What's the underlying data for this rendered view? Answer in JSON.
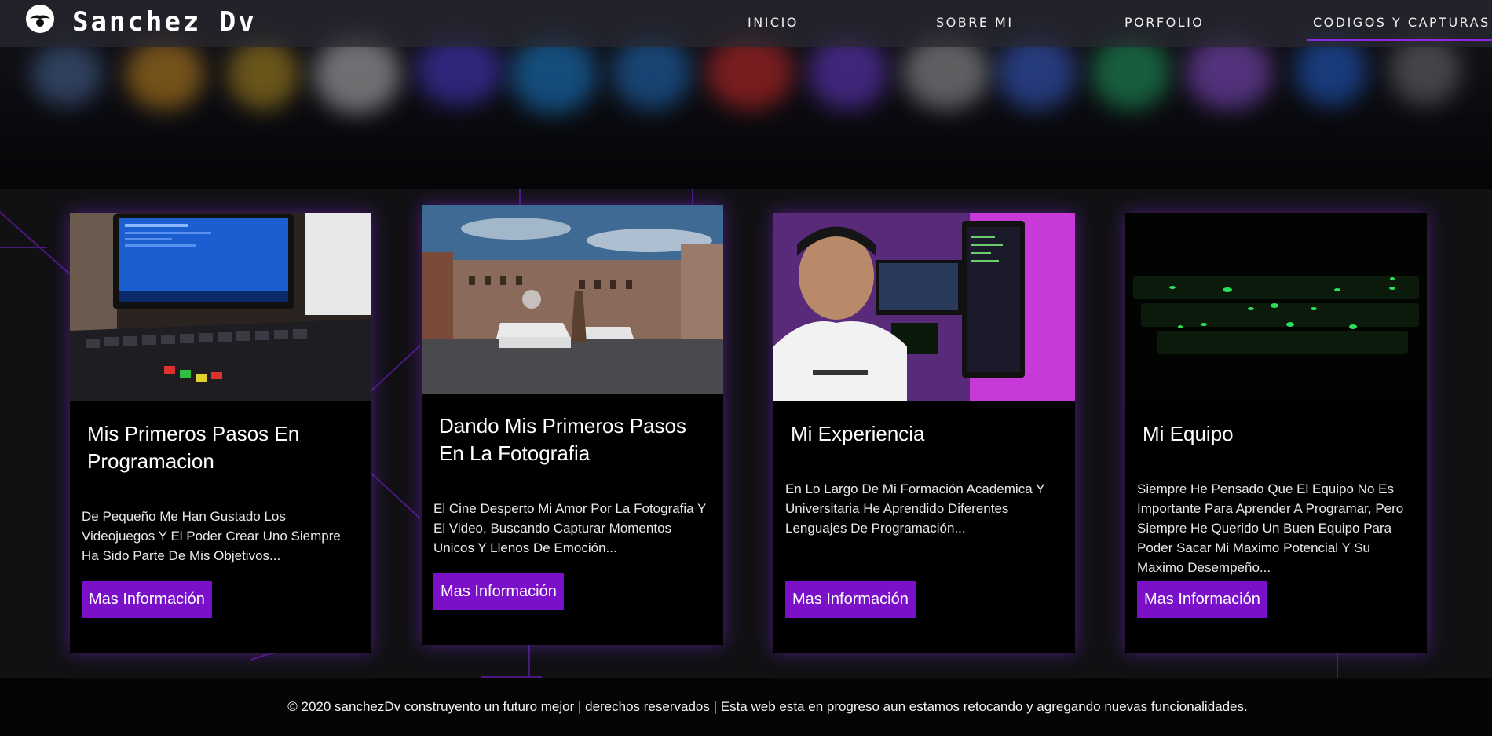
{
  "navbar": {
    "brand": "Sanchez Dv",
    "items": [
      {
        "label": "INICIO"
      },
      {
        "label": "SOBRE MI"
      },
      {
        "label": "PORFOLIO"
      },
      {
        "label": "CODIGOS Y CAPTURAS"
      }
    ],
    "active_index": 3,
    "accent": "#8a2be2"
  },
  "cards": [
    {
      "title": "Mis Primeros Pasos En Programacion",
      "text": "De Pequeño Me Han Gustado Los Videojuegos Y El Poder Crear Uno Siempre Ha Sido Parte De Mis Objetivos...",
      "button": "Mas Información"
    },
    {
      "title": "Dando Mis Primeros Pasos En La Fotografia",
      "text": "El Cine Desperto Mi Amor Por La Fotografia Y El Video, Buscando Capturar Momentos Unicos Y Llenos De Emoción...",
      "button": "Mas Información"
    },
    {
      "title": "Mi Experiencia",
      "text": "En Lo Largo De Mi Formación Academica Y Universitaria He Aprendido Diferentes Lenguajes De Programación...",
      "button": "Mas Información"
    },
    {
      "title": "Mi Equipo",
      "text": "Siempre He Pensado Que El Equipo No Es Importante Para Aprender A Programar, Pero Siempre He Querido Un Buen Equipo Para Poder Sacar Mi Maximo Potencial Y Su Maximo Desempeño...",
      "button": "Mas Información"
    }
  ],
  "footer": {
    "text": "© 2020 sanchezDv construyento un futuro mejor | derechos reservados | Esta web esta en progreso aun estamos retocando y agregando nuevas funcionalidades."
  },
  "colors": {
    "button": "#7a10c8",
    "card_glow": "#7828c8"
  }
}
